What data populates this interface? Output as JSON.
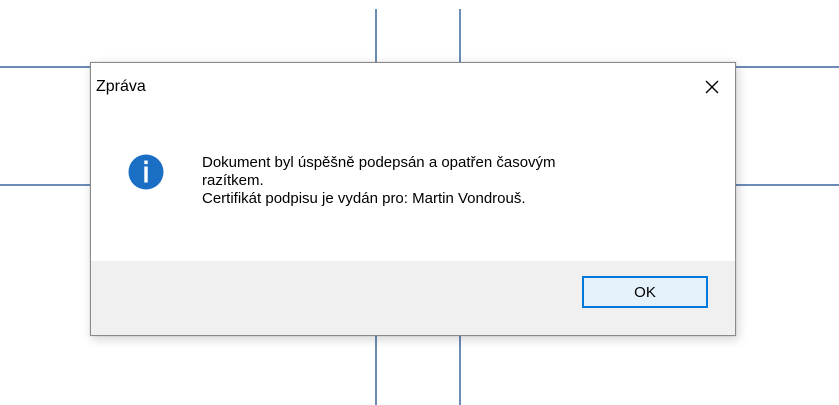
{
  "dialog": {
    "title": "Zpráva",
    "close_icon": "close-icon",
    "info_icon": "info-icon",
    "message_lines": [
      "Dokument byl úspěšně podepsán a opatřen časovým",
      "razítkem.",
      "Certifikát podpisu je vydán pro: Martin Vondrouš."
    ],
    "ok_label": "OK"
  },
  "colors": {
    "accent": "#0078d7",
    "info_icon_fill": "#1a6fc4",
    "footer_bg": "#f0f0f0",
    "background_lines": "#6b8cb8"
  }
}
